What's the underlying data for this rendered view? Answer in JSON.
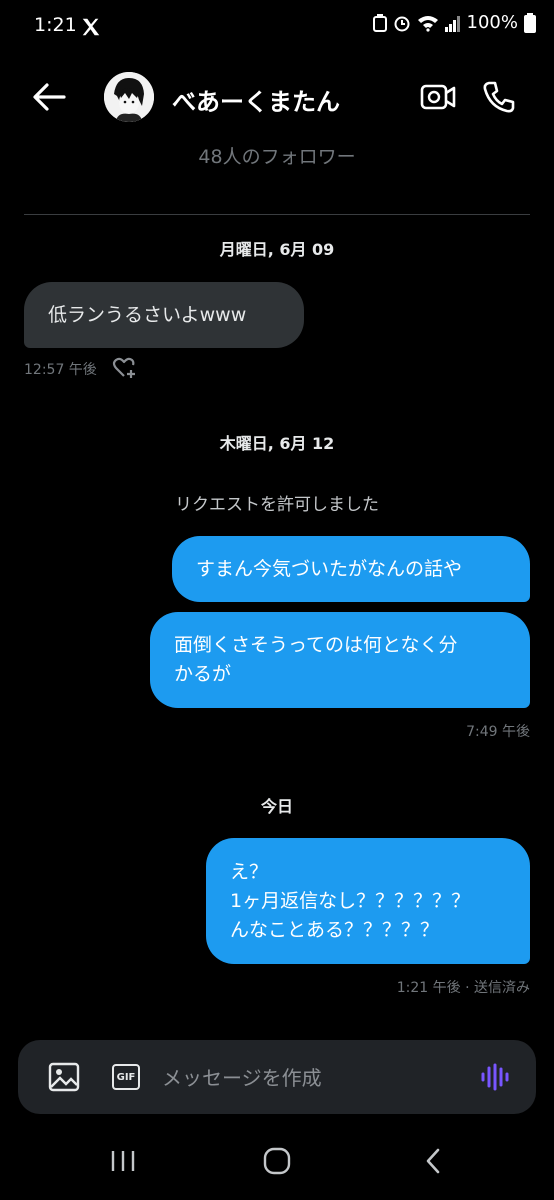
{
  "status_bar": {
    "time": "1:21",
    "battery": "100%"
  },
  "header": {
    "name": "べあーくまたん",
    "followers": "48人のフォロワー"
  },
  "messages": {
    "date_1": "月曜日, 6月 09",
    "msg_1": "低ランうるさいよwww",
    "msg_1_time": "12:57 午後",
    "date_2": "木曜日, 6月 12",
    "system_1": "リクエストを許可しました",
    "msg_2": "すまん今気づいたがなんの話や",
    "msg_3_line1": "面倒くさそうってのは何となく分",
    "msg_3_line2": "かるが",
    "msg_3_time": "7:49 午後",
    "date_3": "今日",
    "msg_4_line1": "え？",
    "msg_4_line2": "1ヶ月返信なし？？？？？？",
    "msg_4_line3": "んなことある？？？？？",
    "msg_4_meta": "1:21 午後 · 送信済み"
  },
  "composer": {
    "placeholder": "メッセージを作成",
    "gif_label": "GIF"
  },
  "colors": {
    "accent": "#1d9bf0",
    "received_bubble": "#2f3336",
    "voice": "#7856ff"
  }
}
